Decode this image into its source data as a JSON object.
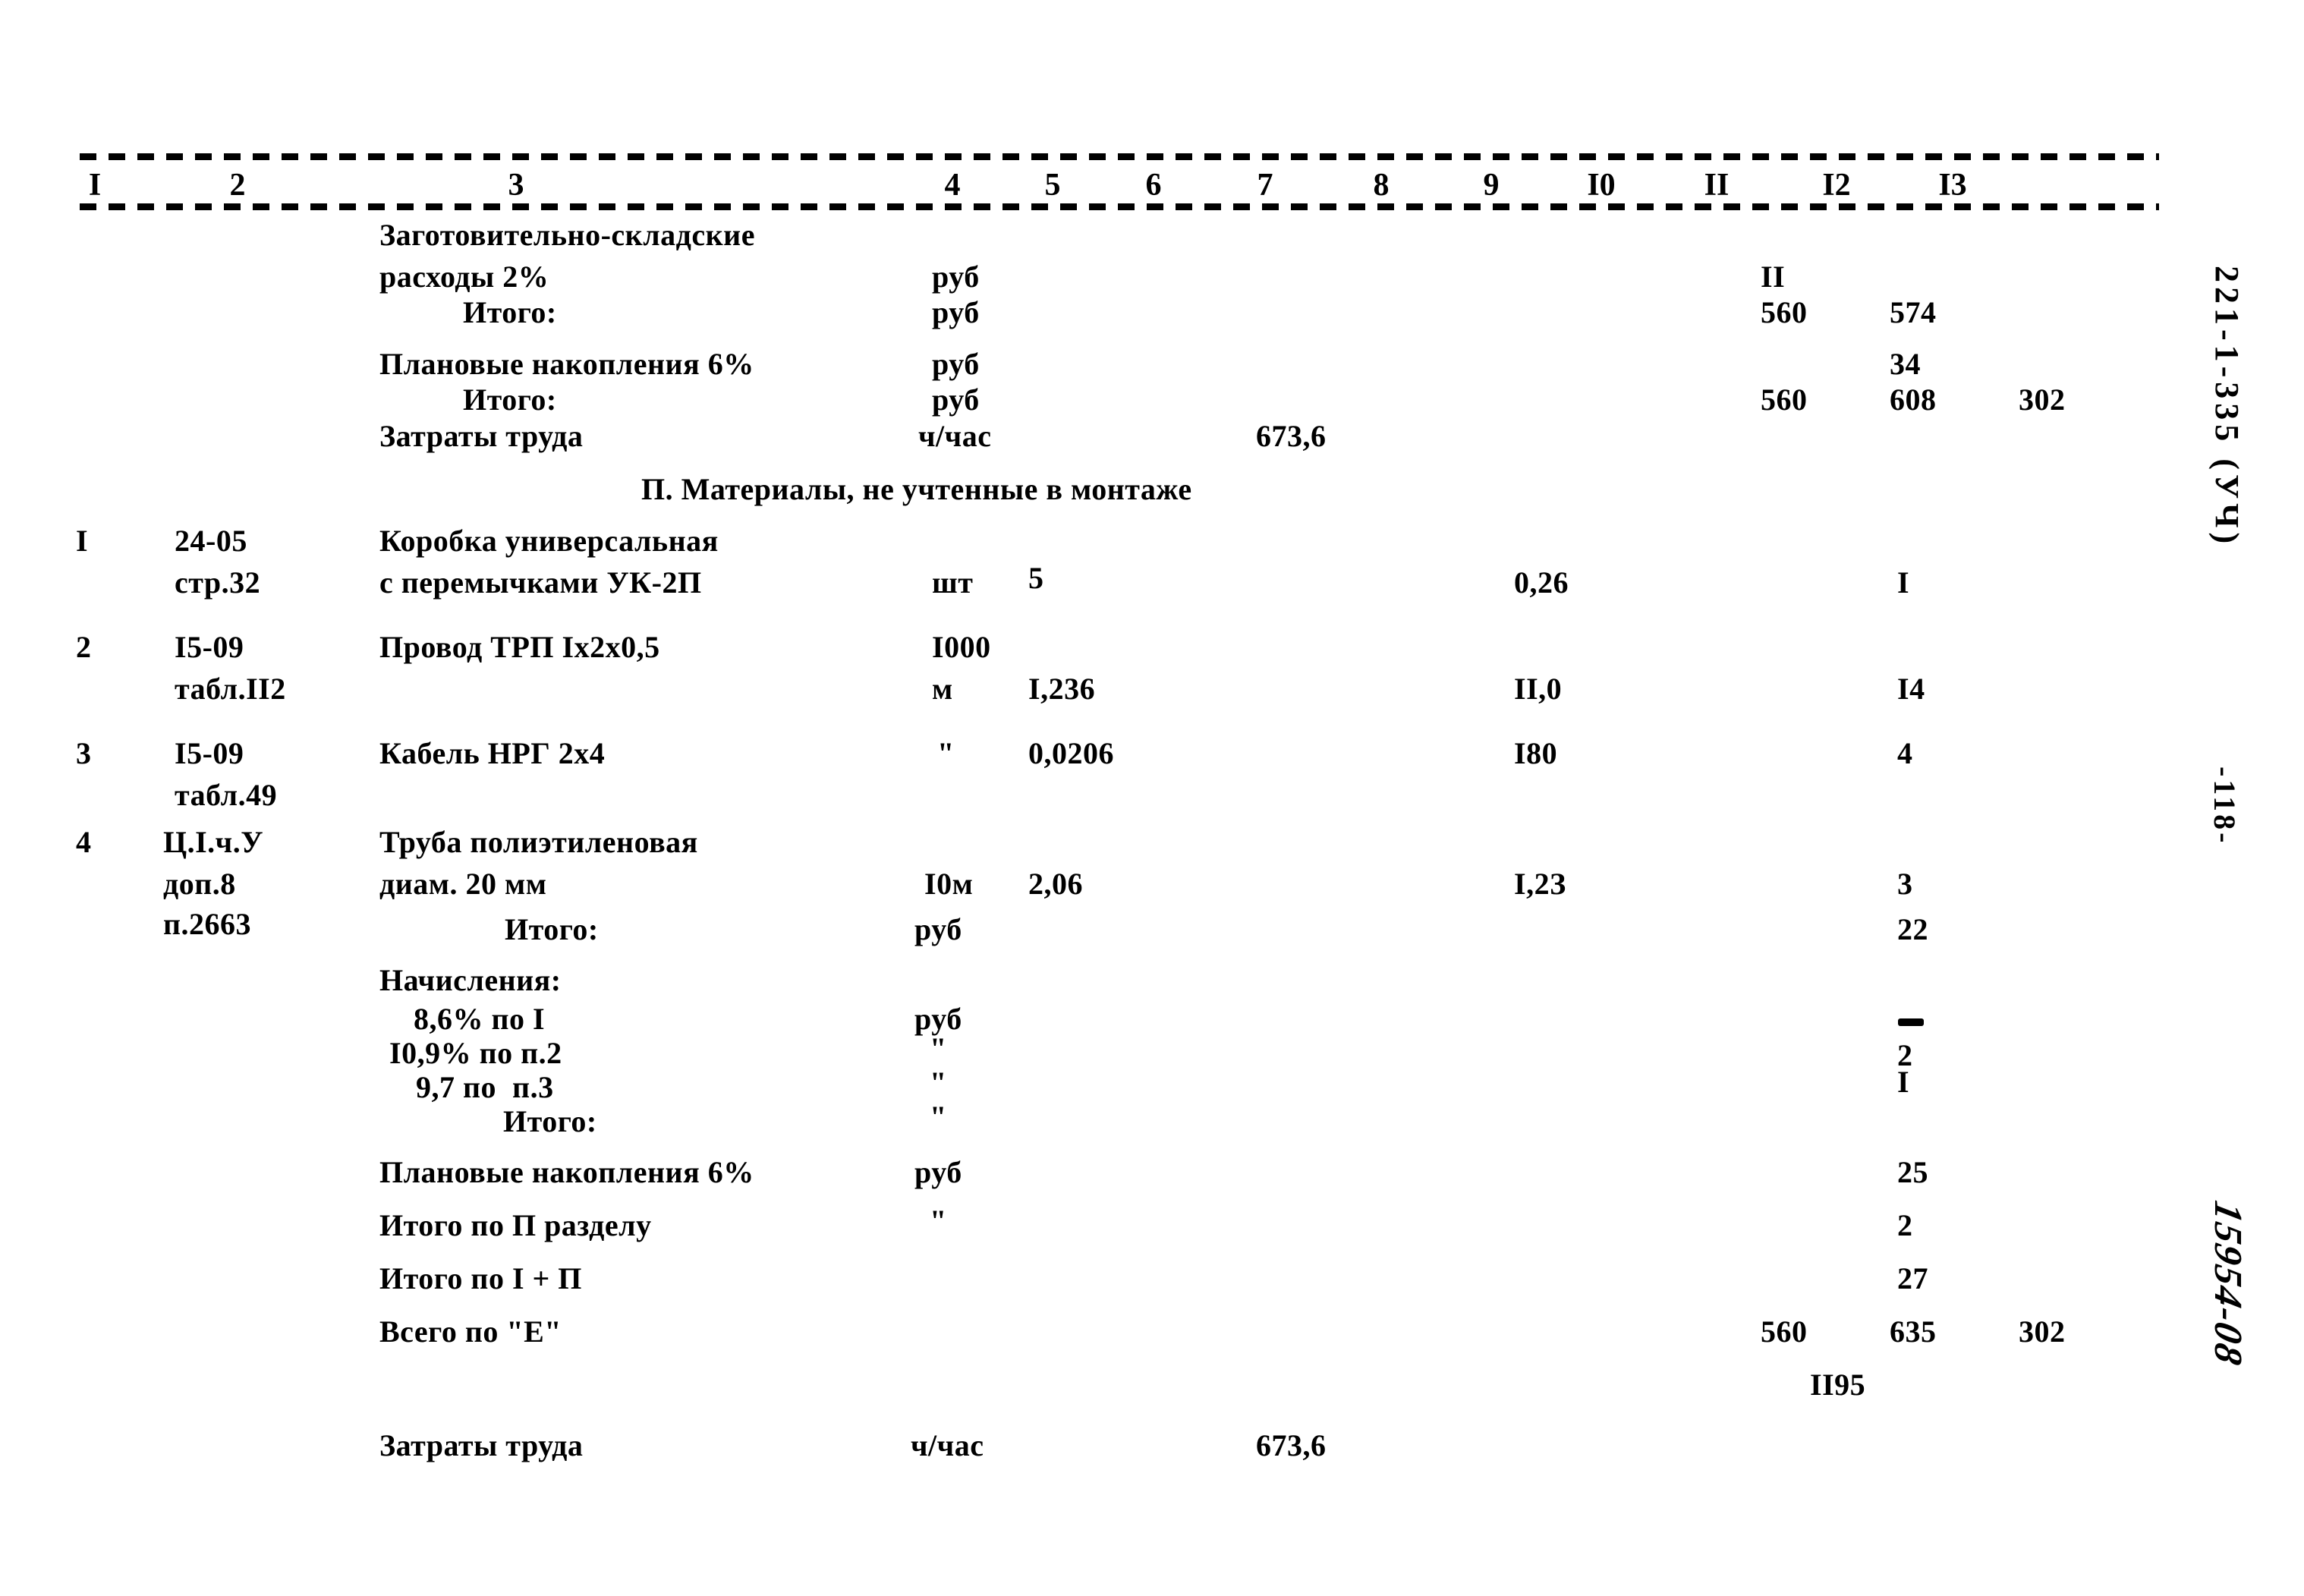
{
  "document": {
    "column_headers": [
      "I",
      "2",
      "3",
      "4",
      "5",
      "6",
      "7",
      "8",
      "9",
      "I0",
      "II",
      "I2",
      "I3"
    ],
    "margin": {
      "code": "221-1-335 (УЧ)",
      "page": "-118-",
      "stamp": "15954-08"
    },
    "section_heading": "П. Материалы, не учтенные в монтаже",
    "top_block": [
      {
        "desc_line1": "Заготовительно-складские",
        "desc_line2": "расходы 2%",
        "unit": "руб",
        "c11": "II",
        "c12": "",
        "c13": ""
      },
      {
        "desc_line1": "",
        "desc_line2": "Итого:",
        "unit": "руб",
        "c11": "560",
        "c12": "574",
        "c13": ""
      },
      {
        "desc_line1": "",
        "desc_line2": "Плановые накопления 6%",
        "unit": "руб",
        "c11": "",
        "c12": "34",
        "c13": ""
      },
      {
        "desc_line1": "",
        "desc_line2": "Итого:",
        "unit": "руб",
        "c11": "560",
        "c12": "608",
        "c13": "302"
      },
      {
        "desc_line1": "",
        "desc_line2": "Затраты труда",
        "unit": "ч/час",
        "c7": "673,6",
        "c11": "",
        "c12": "",
        "c13": ""
      }
    ],
    "items": [
      {
        "no": "I",
        "ref_line1": "24-05",
        "ref_line2": "стр.32",
        "name_line1": "Коробка универсальная",
        "name_line2": "с перемычками УК-2П",
        "unit": "шт",
        "qty": "5",
        "price": "0,26",
        "c12": "I"
      },
      {
        "no": "2",
        "ref_line1": "I5-09",
        "ref_line2": "табл.II2",
        "name_line1": "Провод ТРП Iх2х0,5",
        "name_line2": "",
        "unit_line1": "I000",
        "unit_line2": "м",
        "qty": "I,236",
        "price": "II,0",
        "c12": "I4"
      },
      {
        "no": "3",
        "ref_line1": "I5-09",
        "ref_line2": "табл.49",
        "name_line1": "Кабель НРГ 2х4",
        "name_line2": "",
        "unit": "\"",
        "qty": "0,0206",
        "price": "I80",
        "c12": "4"
      },
      {
        "no": "4",
        "ref_line1": "Ц.I.ч.У",
        "ref_line2": "доп.8",
        "ref_line3": "п.2663",
        "name_line1": "Труба полиэтиленовая",
        "name_line2": "диам. 20 мм",
        "unit": "I0м",
        "qty": "2,06",
        "price": "I,2З",
        "c12": "3"
      }
    ],
    "bottom_block": [
      {
        "label": "Итого:",
        "unit": "руб",
        "c11": "",
        "c12": "22",
        "c13": ""
      },
      {
        "label": "Начисления:",
        "unit": "",
        "c11": "",
        "c12": "",
        "c13": ""
      },
      {
        "label": "8,6% по I",
        "unit": "руб",
        "c11": "",
        "c12": "",
        "c13": ""
      },
      {
        "label": "I0,9% по п.2",
        "unit": "\"",
        "c11": "",
        "c12": "",
        "c13": ""
      },
      {
        "label": "9,7 по  п.3",
        "unit": "\"",
        "c11": "",
        "c12": "2",
        "c13": ""
      },
      {
        "label": "Итого:",
        "unit": "\"",
        "c11": "",
        "c12": "I",
        "c13": ""
      },
      {
        "label": "Плановые накопления 6%",
        "unit": "руб",
        "c11": "",
        "c12": "25",
        "c13": ""
      },
      {
        "label": "Итого по П разделу",
        "unit": "\"",
        "c11": "",
        "c12": "2",
        "c13": ""
      },
      {
        "label": "Итого по I + П",
        "unit": "",
        "c11": "",
        "c12": "27",
        "c13": ""
      },
      {
        "label": "Всего по \"Е\"",
        "unit": "",
        "c11": "560",
        "c12": "635",
        "c13": "302"
      },
      {
        "label": "",
        "unit": "",
        "c11": "",
        "c12": "II95",
        "c13": ""
      }
    ],
    "footer": {
      "label": "Затраты труда",
      "unit": "ч/час",
      "value": "673,6"
    }
  }
}
